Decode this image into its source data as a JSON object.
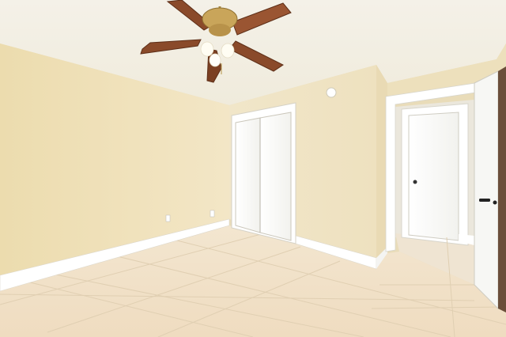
{
  "scene": {
    "ceiling_fan": {
      "blades": 5,
      "light_bulbs": 3
    }
  },
  "colors": {
    "wall": "#eddfb8",
    "ceiling": "#f3efe4",
    "floor": "#f0dfc3",
    "trim": "#ffffff",
    "fan_blade": "#8a4a2a",
    "brass": "#c9a55a"
  }
}
